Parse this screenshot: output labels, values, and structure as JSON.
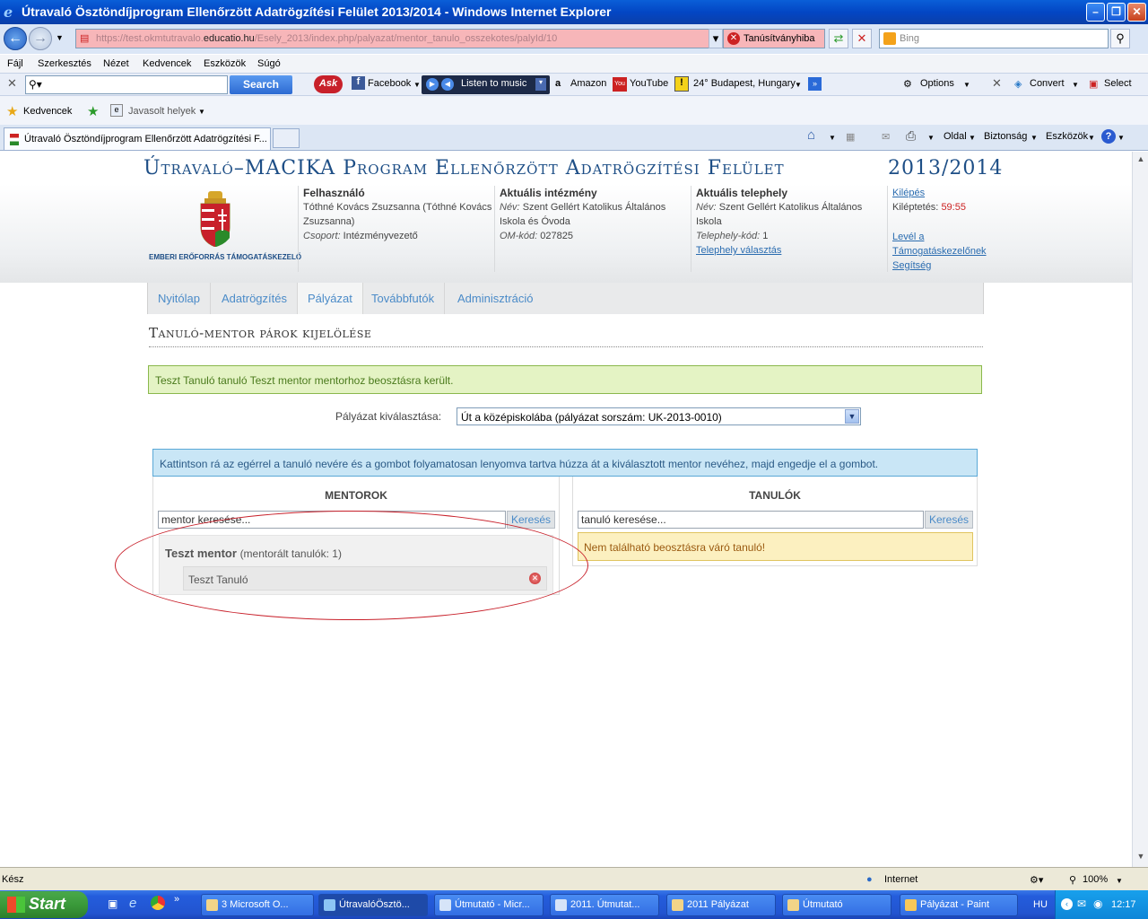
{
  "window": {
    "title": "Útravaló Ösztöndíjprogram Ellenőrzött Adatrögzítési Felület 2013/2014 - Windows Internet Explorer",
    "min": "–",
    "max": "❐",
    "close": "✕"
  },
  "address": {
    "url_prefix": "https://test.okmtutravalo.",
    "url_host": "educatio.hu",
    "url_path": "/Esely_2013/index.php/palyazat/mentor_tanulo_osszekotes/palyId/10",
    "cert_error": "Tanúsítványhiba",
    "search_placeholder": "Bing"
  },
  "menu": [
    "Fájl",
    "Szerkesztés",
    "Nézet",
    "Kedvencek",
    "Eszközök",
    "Súgó"
  ],
  "toolbar": {
    "search_button": "Search",
    "facebook": "Facebook",
    "listen": "Listen to music",
    "amazon": "Amazon",
    "youtube": "YouTube",
    "weather": "24° Budapest, Hungary",
    "options": "Options",
    "convert": "Convert",
    "select": "Select"
  },
  "favorites": {
    "label": "Kedvencek",
    "suggested": "Javasolt helyek"
  },
  "tabs": {
    "active": "Útravaló Ösztöndíjprogram Ellenőrzött Adatrögzítési F...",
    "oldal": "Oldal",
    "biztonsag": "Biztonság",
    "eszkozok": "Eszközök"
  },
  "app": {
    "title": "Útravaló–MACIKA Program Ellenőrzött Adatrögzítési Felület",
    "year": "2013/2014",
    "logo_text": "EMBERI ERŐFORRÁS TÁMOGATÁSKEZELŐ",
    "user": {
      "heading": "Felhasználó",
      "name": "Tóthné Kovács Zsuzsanna (Tóthné Kovács Zsuzsanna)",
      "group_label": "Csoport:",
      "group": "Intézményvezető"
    },
    "institution": {
      "heading": "Aktuális intézmény",
      "name_label": "Név:",
      "name": "Szent Gellért Katolikus Általános Iskola és Óvoda",
      "om_label": "OM-kód:",
      "om": "027825"
    },
    "site": {
      "heading": "Aktuális telephely",
      "name_label": "Név:",
      "name": "Szent Gellért Katolikus Általános Iskola",
      "code_label": "Telephely-kód:",
      "code": "1",
      "select_link": "Telephely választás"
    },
    "links": {
      "logout": "Kilépés",
      "timeout_label": "Kiléptetés:",
      "timeout": "59:55",
      "letter": "Levél a Támogatáskezelőnek",
      "help": "Segítség"
    },
    "nav": [
      "Nyitólap",
      "Adatrögzítés",
      "Pályázat",
      "Továbbfutók",
      "Adminisztráció"
    ],
    "page_title": "Tanuló-mentor párok kijelölése",
    "success": "Teszt Tanuló tanuló Teszt mentor mentorhoz beosztásra került.",
    "select_label": "Pályázat kiválasztása:",
    "select_value": "Út a középiskolába (pályázat sorszám: UK-2013-0010)",
    "instruction": "Kattintson rá az egérrel a tanuló nevére és a gombot folyamatosan lenyomva tartva húzza át a kiválasztott mentor nevéhez, majd engedje el a gombot.",
    "mentors": {
      "heading": "MENTOROK",
      "search_value": "mentor keresése...",
      "search_button": "Keresés",
      "mentor_name": "Teszt mentor",
      "mentor_count": "(mentorált tanulók: 1)",
      "student": "Teszt Tanuló"
    },
    "students": {
      "heading": "TANULÓK",
      "search_value": "tanuló keresése...",
      "search_button": "Keresés",
      "empty": "Nem található beosztásra váró tanuló!"
    }
  },
  "status": {
    "text": "Kész",
    "zone": "Internet",
    "zoom": "100%"
  },
  "taskbar": {
    "start": "Start",
    "tasks": [
      "3 Microsoft O...",
      "ÚtravalóÖsztö...",
      "Útmutató - Micr...",
      "2011. Útmutat...",
      "2011 Pályázat",
      "Útmutató",
      "Pályázat - Paint"
    ],
    "lang": "HU",
    "time": "12:17"
  },
  "colors": {
    "title_blue": "#1d4e86",
    "success_bg": "#e4f3c4",
    "info_bg": "#c9e6f6",
    "warn_bg": "#fcf0c0",
    "annotation": "#c8202a"
  }
}
